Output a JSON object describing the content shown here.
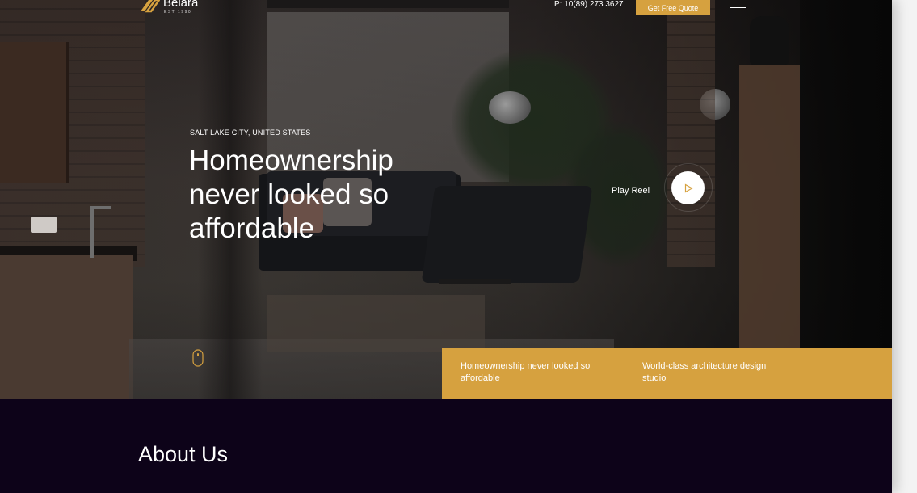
{
  "header": {
    "logo_name": "Belara",
    "logo_tagline": "EST 1990",
    "phone": "P: 10(89) 273 3627",
    "cta_label": "Get Free Quote"
  },
  "hero": {
    "location": "SALT LAKE CITY, UNITED STATES",
    "title": "Homeownership never looked so affordable",
    "play_reel_label": "Play Reel"
  },
  "features": [
    {
      "text": "Homeownership never looked so affordable"
    },
    {
      "text": "World-class architecture design studio"
    }
  ],
  "about": {
    "title": "About Us"
  },
  "colors": {
    "accent": "#d6a13f",
    "dark_background": "#0d0319"
  }
}
